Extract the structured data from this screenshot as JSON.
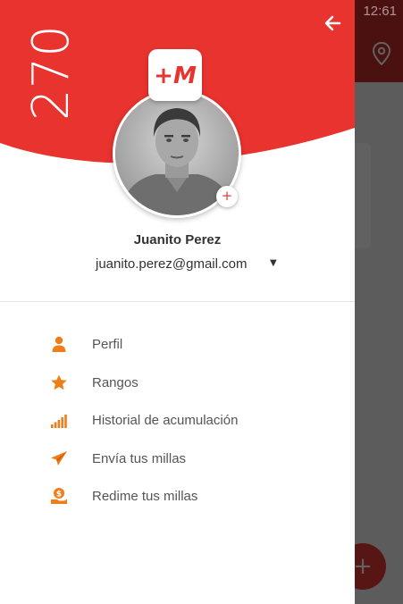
{
  "status_bar": {
    "time": "12:61"
  },
  "drawer": {
    "points": "270",
    "brand_logo": "+M",
    "user": {
      "name": "Juanito Perez",
      "email": "juanito.perez@gmail.com",
      "email_dropdown_icon": "caret-down-icon"
    },
    "menu": [
      {
        "label": "Perfil",
        "icon": "person-icon"
      },
      {
        "label": "Rangos",
        "icon": "star-icon"
      },
      {
        "label": "Historial de acumulación",
        "icon": "signal-bars-icon"
      },
      {
        "label": "Envía tus millas",
        "icon": "paper-plane-icon"
      },
      {
        "label": "Redime tus millas",
        "icon": "coin-hand-icon"
      }
    ]
  },
  "colors": {
    "brand_red": "#e8332f",
    "icon_orange": "#ef7d1a",
    "text_dark": "#333333",
    "text_menu": "#555555"
  }
}
